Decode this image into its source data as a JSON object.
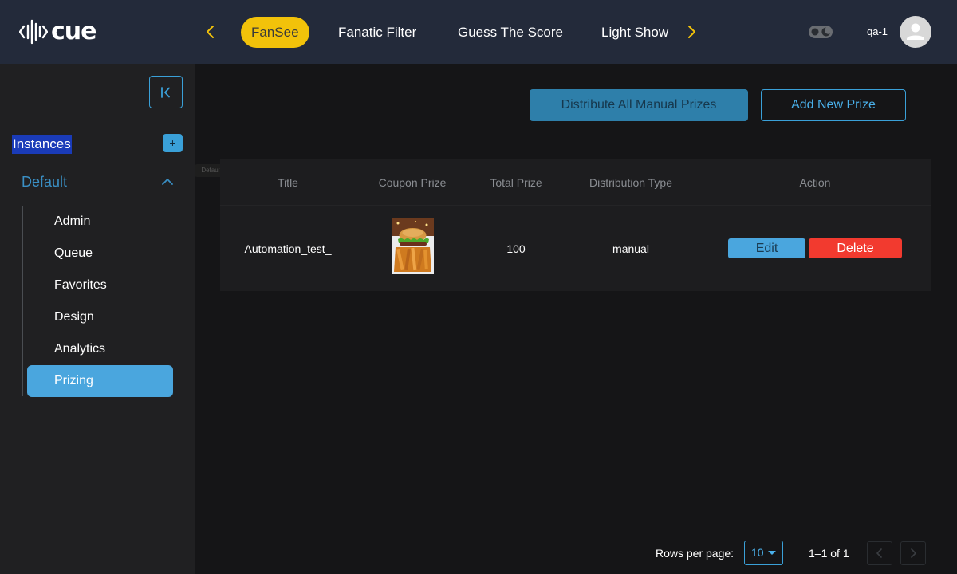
{
  "header": {
    "logo_text": "cue",
    "tabs": [
      {
        "label": "FanSee",
        "active": true
      },
      {
        "label": "Fanatic Filter",
        "active": false
      },
      {
        "label": "Guess The Score",
        "active": false
      },
      {
        "label": "Light Show",
        "active": false
      }
    ],
    "username": "qa-1"
  },
  "sidebar": {
    "instances_label": "Instances",
    "add_label": "+",
    "group_title": "Default",
    "tooltip": "Default",
    "items": [
      {
        "label": "Admin",
        "active": false
      },
      {
        "label": "Queue",
        "active": false
      },
      {
        "label": "Favorites",
        "active": false
      },
      {
        "label": "Design",
        "active": false
      },
      {
        "label": "Analytics",
        "active": false
      },
      {
        "label": "Prizing",
        "active": true
      }
    ]
  },
  "main": {
    "distribute_label": "Distribute All Manual Prizes",
    "add_prize_label": "Add New Prize",
    "table": {
      "columns": [
        "Title",
        "Coupon Prize",
        "Total Prize",
        "Distribution Type",
        "Action"
      ],
      "rows": [
        {
          "title": "Automation_test_",
          "coupon_image": "burger-fries-image",
          "total_prize": "100",
          "distribution_type": "manual",
          "edit_label": "Edit",
          "delete_label": "Delete"
        }
      ]
    }
  },
  "pagination": {
    "rows_per_page_label": "Rows per page:",
    "rows_per_page_value": "10",
    "range_label": "1–1 of 1"
  },
  "colors": {
    "accent": "#3aa0d8",
    "active_tab": "#f2c20a",
    "delete": "#f23a2f",
    "topbar": "#232a3a",
    "sidebar": "#202022"
  }
}
